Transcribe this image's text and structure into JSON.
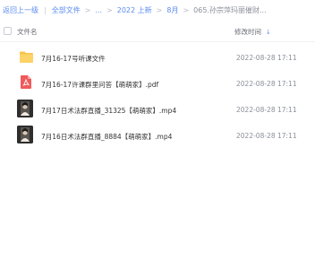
{
  "breadcrumb": {
    "back": "返回上一级",
    "root": "全部文件",
    "ellipsis": "...",
    "level1": "2022 上新",
    "level2": "8月",
    "current": "065.孙宗萍玛丽催财..."
  },
  "header": {
    "name_col": "文件名",
    "modified_col": "修改时间"
  },
  "files": [
    {
      "name": "7月16-17号听课文件",
      "modified": "2022-08-28 17:11",
      "type": "folder-icon"
    },
    {
      "name": "7月16-17许课群里问答【萌萌家】.pdf",
      "modified": "2022-08-28 17:11",
      "type": "pdf-icon"
    },
    {
      "name": "7月17日术法群直播_31325【萌萌家】.mp4",
      "modified": "2022-08-28 17:11",
      "type": "video-icon"
    },
    {
      "name": "7月16日术法群直播_8884【萌萌家】.mp4",
      "modified": "2022-08-28 17:11",
      "type": "video-icon"
    }
  ],
  "colors": {
    "link": "#5b8bf0",
    "folder": "#f7c44e",
    "pdf": "#f05a5a"
  }
}
